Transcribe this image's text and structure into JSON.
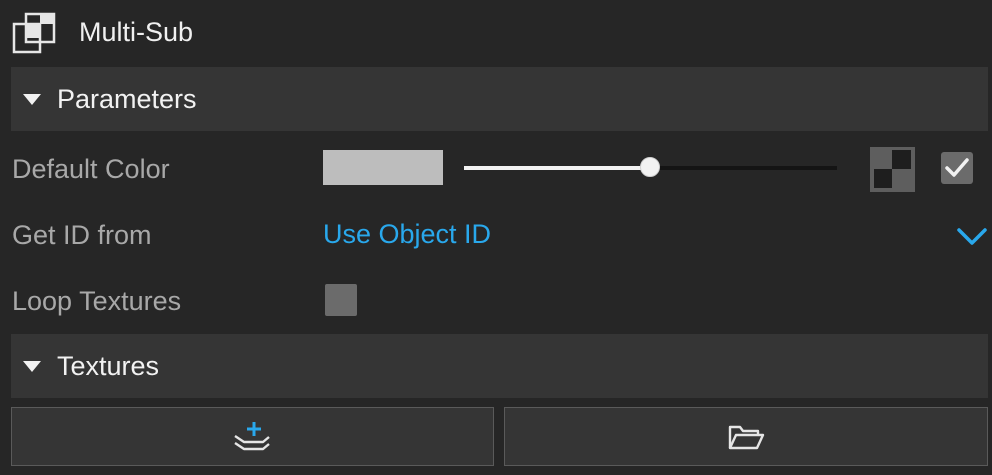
{
  "header": {
    "title": "Multi-Sub",
    "icon": "multi-sub-material-icon"
  },
  "sections": {
    "parameters": {
      "label": "Parameters"
    },
    "textures": {
      "label": "Textures"
    }
  },
  "params": {
    "default_color": {
      "label": "Default Color",
      "swatch_color": "#bdbdbd",
      "slider_value": 0.5
    },
    "get_id_from": {
      "label": "Get ID from",
      "value": "Use Object ID"
    },
    "loop_textures": {
      "label": "Loop Textures",
      "checked": false
    }
  },
  "colors": {
    "accent": "#29a8ec",
    "panel": "#262626",
    "section": "#353535"
  },
  "textures_toolbar": {
    "add_icon": "add-layer-icon",
    "open_icon": "folder-open-icon"
  }
}
